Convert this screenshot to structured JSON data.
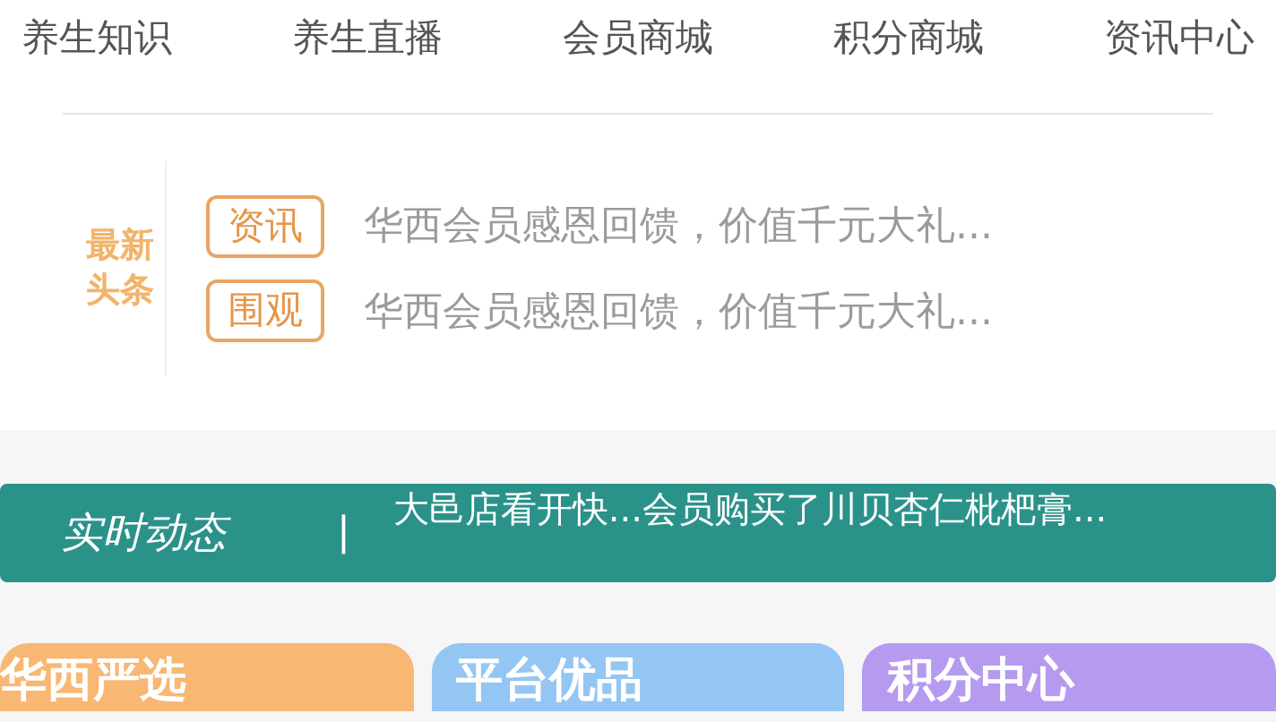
{
  "nav": [
    {
      "label": "养生知识"
    },
    {
      "label": "养生直播"
    },
    {
      "label": "会员商城"
    },
    {
      "label": "积分商城"
    },
    {
      "label": "资讯中心"
    }
  ],
  "headlines": {
    "logo_top": "最新",
    "logo_bottom": "头条",
    "items": [
      {
        "tag": "资讯",
        "text": "华西会员感恩回馈，价值千元大礼..."
      },
      {
        "tag": "围观",
        "text": "华西会员感恩回馈，价值千元大礼..."
      }
    ]
  },
  "ticker": {
    "title": "实时动态",
    "separator": "|",
    "items": [
      "大邑店看开快...会员购买了川贝杏仁枇杷膏..."
    ]
  },
  "cards": [
    {
      "title": "华西严选",
      "color": "#f8b772"
    },
    {
      "title": "平台优品",
      "color": "#94c6f3"
    },
    {
      "title": "积分中心",
      "color": "#b59af0"
    }
  ]
}
